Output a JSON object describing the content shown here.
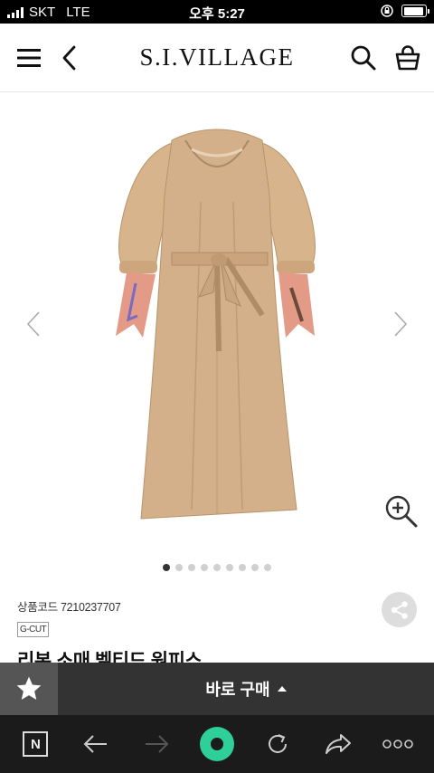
{
  "status": {
    "carrier": "SKT",
    "network": "LTE",
    "time": "오후 5:27",
    "battery_level": 0.95
  },
  "header": {
    "logo": "S.I.VILLAGE",
    "icons": [
      "menu-icon",
      "back-icon",
      "search-icon",
      "cart-icon"
    ]
  },
  "product": {
    "image_pagination": {
      "total": 9,
      "current": 1
    },
    "code_label": "상품코드",
    "code": "7210237707",
    "brand": "G-CUT",
    "title": "리본 소매 벨티드 원피스",
    "colors": {
      "dress": "#d3b08a",
      "accent": "#2fcf9a"
    }
  },
  "actions": {
    "buy_label": "바로 구매"
  },
  "browser": {
    "n_label": "N"
  }
}
